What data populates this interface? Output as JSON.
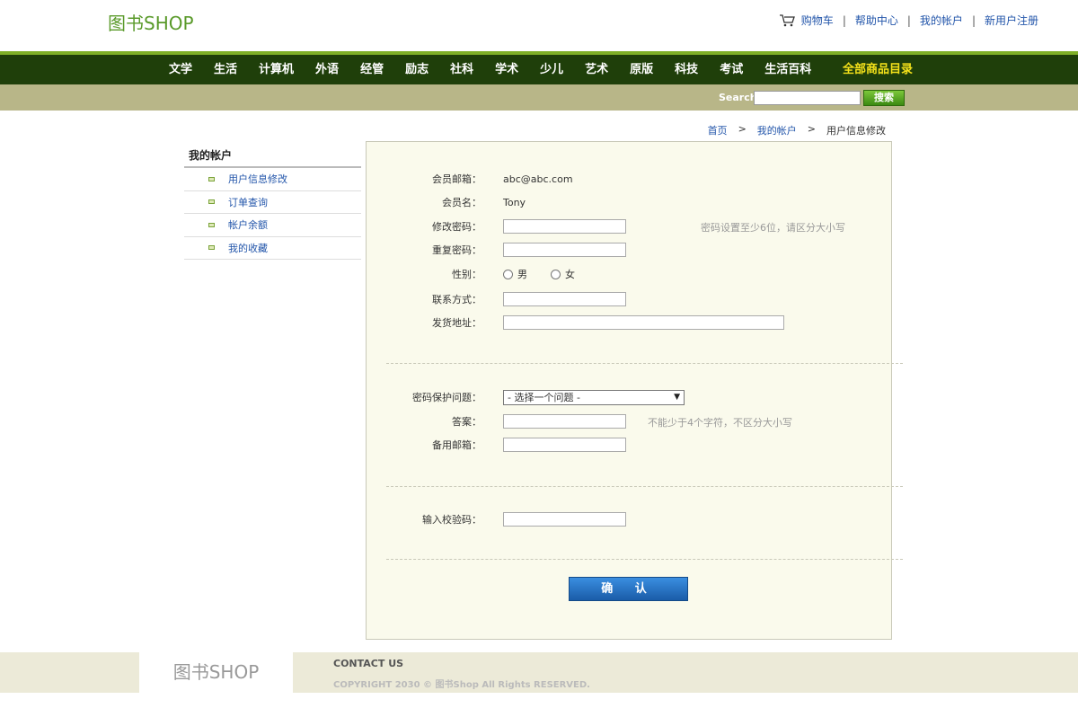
{
  "header": {
    "logo": "图书SHOP",
    "links": {
      "cart": "购物车",
      "help": "帮助中心",
      "account": "我的帐户",
      "register": "新用户注册"
    },
    "separator": "|"
  },
  "nav": {
    "items": [
      "文学",
      "生活",
      "计算机",
      "外语",
      "经管",
      "励志",
      "社科",
      "学术",
      "少儿",
      "艺术",
      "原版",
      "科技",
      "考试",
      "生活百科"
    ],
    "all_catalog": "全部商品目录"
  },
  "search": {
    "label": "Search",
    "button": "搜索"
  },
  "breadcrumb": {
    "home": "首页",
    "account": "我的帐户",
    "current": "用户信息修改",
    "separator": ">"
  },
  "sidebar": {
    "title": "我的帐户",
    "items": [
      "用户信息修改",
      "订单查询",
      "帐户余额",
      "我的收藏"
    ]
  },
  "form": {
    "email_label": "会员邮箱：",
    "email_value": "abc@abc.com",
    "username_label": "会员名：",
    "username_value": "Tony",
    "password_label": "修改密码：",
    "password_hint": "密码设置至少6位，请区分大小写",
    "repeat_password_label": "重复密码：",
    "gender_label": "性别：",
    "gender_male": "男",
    "gender_female": "女",
    "contact_label": "联系方式：",
    "address_label": "发货地址：",
    "question_label": "密码保护问题：",
    "question_selected": "- 选择一个问题 -",
    "answer_label": "答案：",
    "answer_hint": "不能少于4个字符，不区分大小写",
    "backup_email_label": "备用邮箱：",
    "captcha_label": "输入校验码：",
    "confirm_button": "确 认"
  },
  "footer": {
    "logo": "图书SHOP",
    "contact": "CONTACT US",
    "copyright": "COPYRIGHT 2030 © 图书Shop All Rights RESERVED."
  },
  "colors": {
    "nav_bg": "#1f3f0a",
    "nav_accent": "#7fb027",
    "search_bar_bg": "#b8b688",
    "panel_bg": "#fafaec",
    "link": "#2255aa",
    "all_catalog": "#f5e21a"
  }
}
